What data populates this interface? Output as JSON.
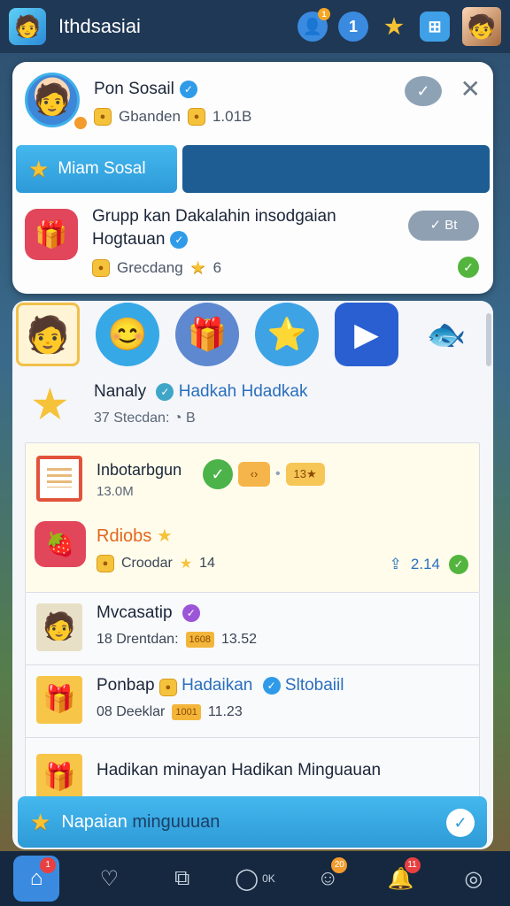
{
  "app": {
    "title": "Ithdsasiai"
  },
  "topbar": {
    "badge_user": "1",
    "num_label": "1"
  },
  "profile": {
    "name": "Pon Sosail",
    "sub_label": "Gbanden",
    "sub_value": "1.01B",
    "tab_active": "Miam Sosal",
    "group_title": "Grupp kan Dakalahin insodgaian Hogtauan",
    "group_sub": "Grecdang",
    "group_count": "6",
    "pill_label": "Bt"
  },
  "featured": {
    "name": "Nanaly",
    "link": "Hadkah Hdadkak",
    "sub": "37 Stecdan:",
    "sub_suffix": "B"
  },
  "card": {
    "title": "Inbotarbgun",
    "subtitle": "13.0M",
    "badge_num": "13",
    "highlight": "Rdiobs",
    "meta_label": "Croodar",
    "meta_value": "14",
    "right_value": "2.14"
  },
  "rows": [
    {
      "title": "Mvcasatip",
      "link": "",
      "link2": "",
      "meta_label": "18 Drentdan:",
      "tag": "1608",
      "value": "13.52"
    },
    {
      "title": "Ponbap",
      "link": "Hadaikan",
      "link2": "Sltobaiil",
      "meta_label": "08 Deeklar",
      "tag": "1001",
      "value": "11.23"
    },
    {
      "title": "Hadikan minayan Hadikan Minguauan",
      "link": "",
      "link2": "",
      "meta_label": "",
      "tag": "",
      "value": ""
    }
  ],
  "banner": {
    "label": "Napaian",
    "label2": "minguuuan"
  },
  "nav": {
    "home_badge": "1",
    "ok_label": "0K",
    "badge_mid": "20",
    "badge_bell": "11"
  }
}
